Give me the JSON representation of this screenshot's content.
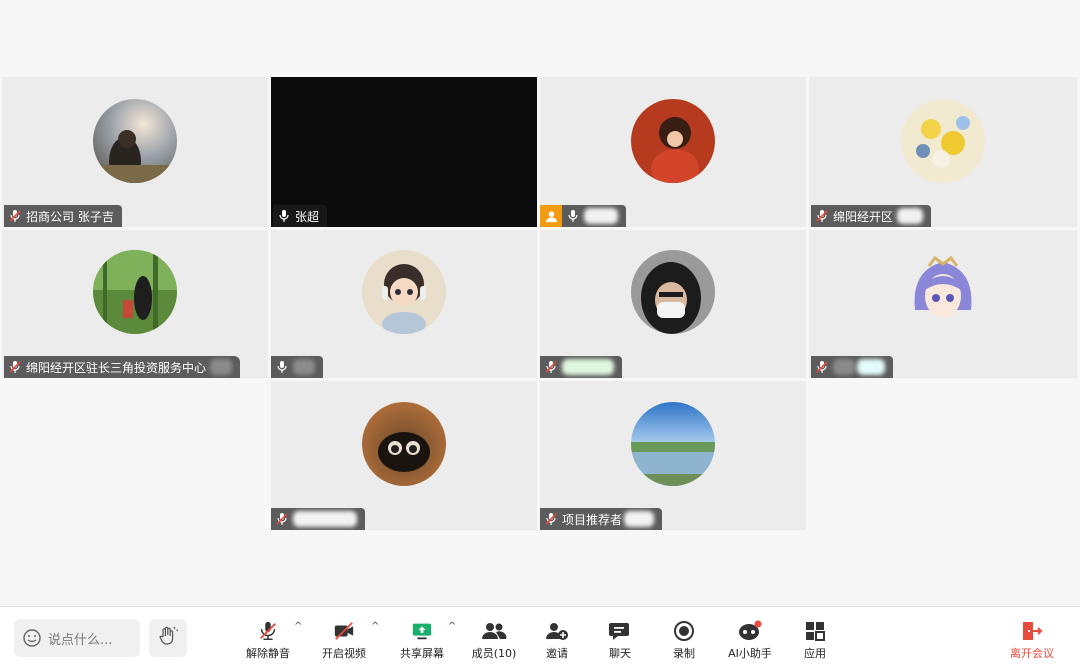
{
  "tiles": {
    "t1": {
      "name": "招商公司 张子吉"
    },
    "t2": {
      "name": "张超"
    },
    "t3": {
      "name": ""
    },
    "t4": {
      "name": "绵阳经开区"
    },
    "t5": {
      "name": "绵阳经开区驻长三角投资服务中心"
    },
    "t6": {
      "name": ""
    },
    "t7": {
      "name": ""
    },
    "t8": {
      "name": ""
    },
    "t9": {
      "name": ""
    },
    "t10": {
      "name": "项目推荐者"
    }
  },
  "toolbar": {
    "chat_placeholder": "说点什么...",
    "unmute": "解除静音",
    "start_video": "开启视频",
    "share_screen": "共享屏幕",
    "members": "成员(10)",
    "invite": "邀请",
    "chat": "聊天",
    "record": "录制",
    "ai_assistant": "AI小助手",
    "apps": "应用",
    "leave": "离开会议"
  },
  "colors": {
    "leave": "#e84a3c",
    "host_badge": "#f39c12",
    "share": "#1aae6b",
    "ai_dot": "#e84a3c"
  }
}
